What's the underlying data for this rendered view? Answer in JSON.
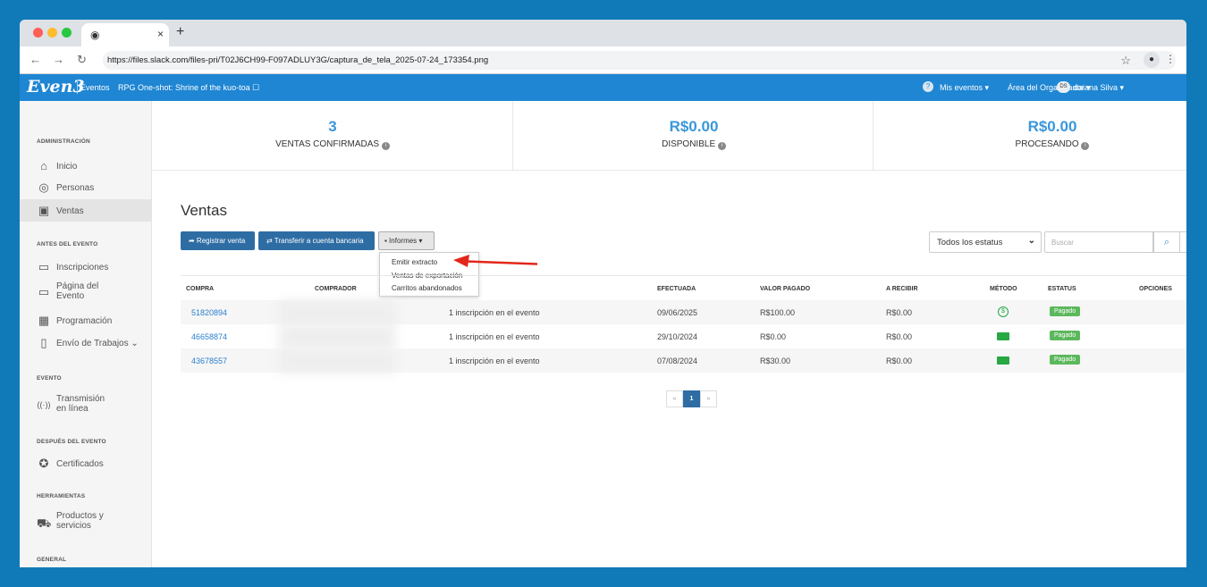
{
  "browser": {
    "url": "https://files.slack.com/files-pri/T02J6CH99-F097ADLUY3G/captura_de_tela_2025-07-24_173354.png",
    "tab_close": "×",
    "new_tab": "+"
  },
  "appnav": {
    "logo": "Even3",
    "eventos": "Eventos",
    "event_name": "RPG One-shot: Shrine of the kuo-toa ☐",
    "mis_eventos": "Mis eventos ▾",
    "area": "Área del Organizador ▾",
    "avatar": "DS",
    "user": "daiana Silva ▾"
  },
  "sidebar": {
    "sections": {
      "admin": "ADMINISTRACIÓN",
      "antes": "ANTES DEL EVENTO",
      "evento": "EVENTO",
      "despues": "DESPUÉS DEL EVENTO",
      "herramientas": "HERRAMIENTAS",
      "general": "GENERAL"
    },
    "items": {
      "inicio": "Inicio",
      "personas": "Personas",
      "ventas": "Ventas",
      "inscripciones": "Inscripciones",
      "pagina1": "Página del",
      "pagina2": "Evento",
      "programacion": "Programación",
      "envio": "Envío de Trabajos ⌄",
      "transmision1": "Transmisión",
      "transmision2": "en línea",
      "certificados": "Certificados",
      "productos1": "Productos y",
      "productos2": "servicios"
    }
  },
  "stats": [
    {
      "value": "3",
      "label": "VENTAS CONFIRMADAS"
    },
    {
      "value": "R$0.00",
      "label": "DISPONIBLE"
    },
    {
      "value": "R$0.00",
      "label": "PROCESANDO"
    }
  ],
  "main": {
    "title": "Ventas",
    "btn_registrar": "➦ Registrar venta",
    "btn_transferir": "⇄ Transferir a cuenta bancaria",
    "btn_informes": "▪ Informes ▾",
    "dropdown": [
      "Emitir extracto",
      "Ventas de exportación",
      "Carritos abandonados"
    ],
    "status_select": "Todos los estatus",
    "search_placeholder": "Buscar"
  },
  "table": {
    "headers": {
      "compra": "COMPRA",
      "comprador": "COMPRADOR",
      "efectuada": "EFECTUADA",
      "valor": "VALOR PAGADO",
      "recibir": "A RECIBIR",
      "metodo": "MÉTODO",
      "estatus": "ESTATUS",
      "opciones": "OPCIONES"
    },
    "rows": [
      {
        "compra": "51820894",
        "desc": "1 inscripción en el evento",
        "fecha": "09/06/2025",
        "valor": "R$100.00",
        "recibir": "R$0.00",
        "metodo": "pix-icon",
        "estatus": "Pagado"
      },
      {
        "compra": "46658874",
        "desc": "1 inscripción en el evento",
        "fecha": "29/10/2024",
        "valor": "R$0.00",
        "recibir": "R$0.00",
        "metodo": "cash-icon",
        "estatus": "Pagado"
      },
      {
        "compra": "43678557",
        "desc": "1 inscripción en el evento",
        "fecha": "07/08/2024",
        "valor": "R$30.00",
        "recibir": "R$0.00",
        "metodo": "cash-icon",
        "estatus": "Pagado"
      }
    ]
  },
  "pager": {
    "prev": "«",
    "current": "1",
    "next": "»"
  },
  "colors": {
    "brand": "#1f86d3",
    "accent": "#3a97d9",
    "button": "#2e6da4",
    "paid": "#5cb85c",
    "arrow": "#e3261b"
  }
}
